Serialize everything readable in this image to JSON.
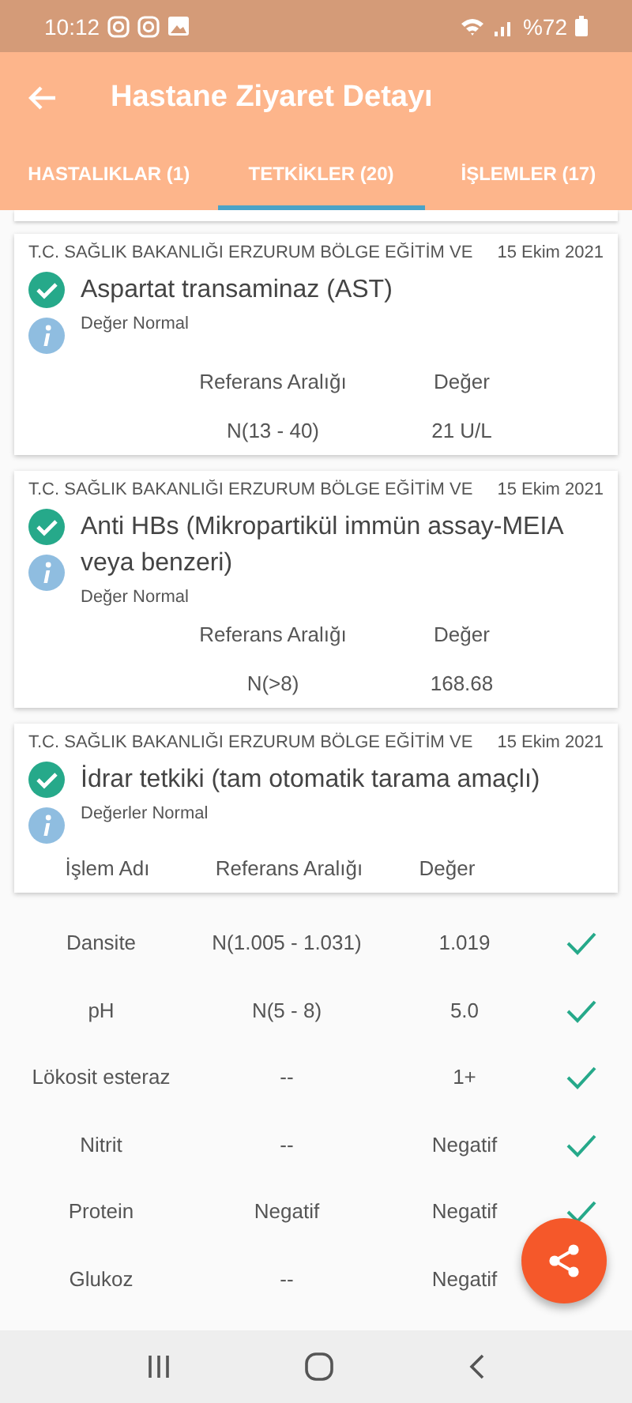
{
  "status_bar": {
    "time": "10:12",
    "battery": "%72"
  },
  "app_bar": {
    "title": "Hastane Ziyaret Detayı"
  },
  "tabs": [
    {
      "label": "HASTALIKLAR (1)",
      "selected": false
    },
    {
      "label": "TETKİKLER (20)",
      "selected": true
    },
    {
      "label": "İŞLEMLER (17)",
      "selected": false
    }
  ],
  "tests": [
    {
      "hospital": "T.C. SAĞLIK BAKANLIĞI ERZURUM BÖLGE EĞİTİM VE",
      "date": "15 Ekim 2021",
      "name": "Aspartat transaminaz (AST)",
      "status": "Değer Normal",
      "normal": true,
      "columns": [
        "Referans Aralığı",
        "Değer"
      ],
      "rows": [
        [
          "N(13 - 40)",
          "21 U/L"
        ]
      ]
    },
    {
      "hospital": "T.C. SAĞLIK BAKANLIĞI ERZURUM BÖLGE EĞİTİM VE",
      "date": "15 Ekim 2021",
      "name": "Anti HBs (Mikropartikül immün assay-MEIA veya benzeri)",
      "status": "Değer Normal",
      "normal": true,
      "columns": [
        "Referans Aralığı",
        "Değer"
      ],
      "rows": [
        [
          "N(>8)",
          "168.68"
        ]
      ]
    },
    {
      "hospital": "T.C. SAĞLIK BAKANLIĞI ERZURUM BÖLGE EĞİTİM VE",
      "date": "15 Ekim 2021",
      "name": "İdrar tetkiki (tam otomatik tarama amaçlı)",
      "status": "Değerler Normal",
      "normal": true,
      "columns": [
        "İşlem Adı",
        "Referans Aralığı",
        "Değer"
      ]
    }
  ],
  "results": [
    {
      "name": "Dansite",
      "reference": "N(1.005 - 1.031)",
      "value": "1.019",
      "ok": true
    },
    {
      "name": "pH",
      "reference": "N(5 - 8)",
      "value": "5.0",
      "ok": true
    },
    {
      "name": "Lökosit esteraz",
      "reference": "--",
      "value": "1+",
      "ok": true
    },
    {
      "name": "Nitrit",
      "reference": "--",
      "value": "Negatif",
      "ok": true
    },
    {
      "name": "Protein",
      "reference": "Negatif",
      "value": "Negatif",
      "ok": true
    },
    {
      "name": "Glukoz",
      "reference": "--",
      "value": "Negatif"
    }
  ]
}
